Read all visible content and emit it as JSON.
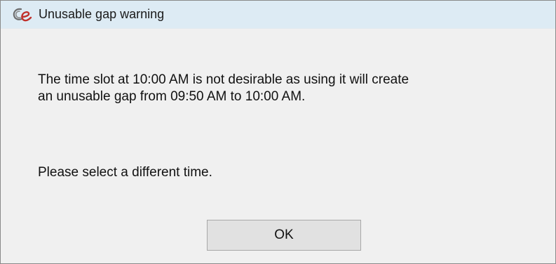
{
  "window": {
    "title": "Unusable gap warning",
    "icon": "ce-logo-icon"
  },
  "message": {
    "line1": "The time slot at 10:00 AM is not desirable as using it will create",
    "line2": "an unusable gap from 09:50 AM to 10:00 AM.",
    "prompt": "Please select a different time."
  },
  "buttons": {
    "ok_label": "OK"
  },
  "colors": {
    "titlebar": "#ddebf4",
    "body": "#f0f0f0",
    "icon_red": "#c0302b",
    "icon_gray": "#6d6d6d"
  }
}
